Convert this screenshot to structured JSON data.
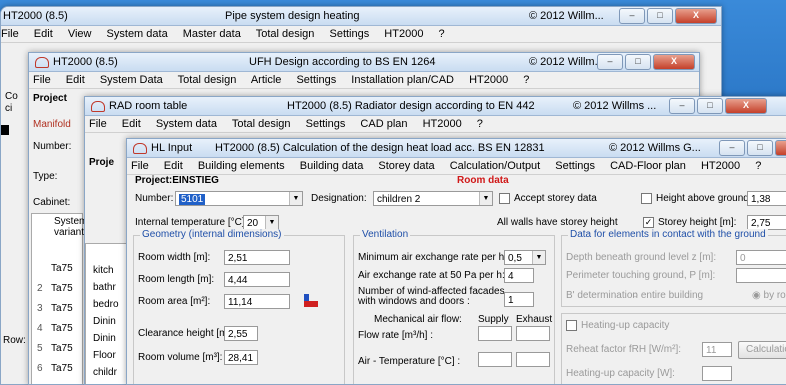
{
  "win1": {
    "title_left": "HT2000 (8.5)",
    "title_mid": "Pipe system design heating",
    "title_right": "© 2012 Willm...",
    "menu": [
      "File",
      "Edit",
      "View",
      "System data",
      "Master data",
      "Total design",
      "Settings",
      "HT2000",
      "?"
    ],
    "side_labels": [
      "Co",
      "ci"
    ],
    "rows_label": "Row:"
  },
  "win2": {
    "title_left": "HT2000 (8.5)",
    "title_mid": "UFH Design according to BS EN 1264",
    "title_right": "© 2012 Willm...",
    "menu": [
      "File",
      "Edit",
      "System Data",
      "Total design",
      "Article",
      "Settings",
      "Installation plan/CAD",
      "HT2000",
      "?"
    ],
    "project_label": "Project",
    "left_labels": [
      "Manifold",
      "Number:",
      "Type:",
      "Cabinet:"
    ],
    "table_head": [
      "System",
      "variant"
    ],
    "rows": [
      "Ta75",
      "Ta75",
      "Ta75",
      "Ta75",
      "Ta75",
      "Ta75"
    ],
    "row_nums": [
      "",
      "2",
      "3",
      "4",
      "5",
      "6"
    ]
  },
  "win3": {
    "title_left": "RAD room table",
    "title_mid": "HT2000 (8.5)  Radiator design according to EN 442",
    "title_right": "© 2012 Willms ...",
    "menu": [
      "File",
      "Edit",
      "System data",
      "Total design",
      "Settings",
      "CAD plan",
      "HT2000",
      "?"
    ],
    "project_label": "Proje",
    "rooms": [
      "kitch",
      "bathr",
      "bedro",
      "Dinin",
      "Dinin",
      "Floor",
      "childr"
    ]
  },
  "win4": {
    "title_left": "HL Input",
    "title_mid": "HT2000 (8.5)  Calculation of the design heat load acc. BS EN 12831",
    "title_right": "© 2012 Willms G...",
    "menu": [
      "File",
      "Edit",
      "Building elements",
      "Building data",
      "Storey data",
      "Calculation/Output",
      "Settings",
      "CAD-Floor plan",
      "HT2000",
      "?"
    ],
    "project": "Project:EINSTIEG",
    "room_data": "Room data",
    "number_label": "Number:",
    "number_value": "5101",
    "designation_label": "Designation:",
    "designation_value": "children 2",
    "accept_storey": "Accept storey data",
    "height_above_ground": "Height above ground [m]:",
    "height_above_ground_value": "1,38",
    "internal_temp_label": "Internal temperature [°C]:",
    "internal_temp_value": "20",
    "all_walls": "All walls have storey height",
    "storey_height_label": "Storey height [m]:",
    "storey_height_value": "2,75",
    "geometry": {
      "title": "Geometry (internal dimensions)",
      "room_width_label": "Room width [m]:",
      "room_width": "2,51",
      "room_length_label": "Room length [m]:",
      "room_length": "4,44",
      "room_area_label": "Room area [m²]:",
      "room_area": "11,14",
      "clearance_label": "Clearance height [m]:",
      "clearance": "2,55",
      "volume_label": "Room volume [m³]:",
      "volume": "28,41"
    },
    "ventilation": {
      "title": "Ventilation",
      "min_air_label": "Minimum air exchange rate per h:",
      "min_air": "0,5",
      "air50_label": "Air exchange rate at 50 Pa per h:",
      "air50": "4",
      "facades_label1": "Number of wind-affected facades",
      "facades_label2": "with windows and doors :",
      "facades": "1",
      "mech_label": "Mechanical air flow:",
      "supply": "Supply",
      "exhaust": "Exhaust",
      "flow_rate": "Flow rate [m³/h] :",
      "air_temp": "Air - Temperature [°C] :"
    },
    "ground": {
      "title": "Data for elements in contact with the ground",
      "depth": "Depth beneath ground level z [m]:",
      "depth_value": "0",
      "perimeter": "Perimeter touching ground, P [m]:",
      "bdet": "B' determination",
      "entire": "entire building",
      "byroom": "by room"
    },
    "heatup": {
      "title": "Heating-up capacity",
      "reheat": "Reheat factor fRH [W/m²]:",
      "reheat_value": "11",
      "calc_btn": "Calculatio",
      "capacity": "Heating-up capacity [W]:"
    }
  },
  "colors": {
    "accent": "#1f4fa8",
    "warn": "#d01818",
    "selected": "#2060c8"
  }
}
